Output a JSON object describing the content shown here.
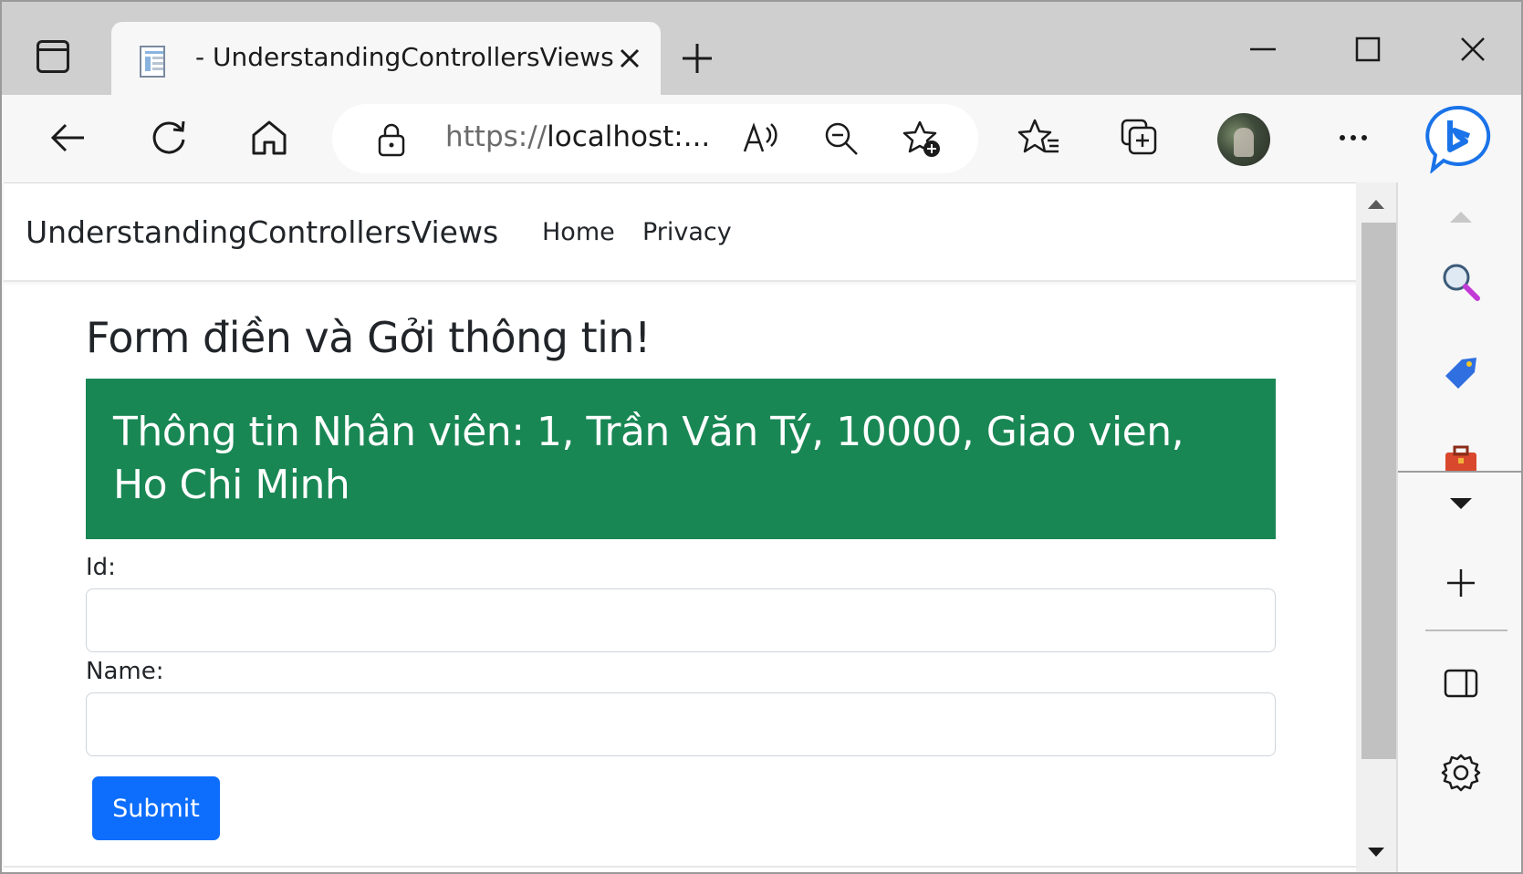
{
  "browser": {
    "tab_title": "- UnderstandingControllersViews",
    "url_protocol": "https://",
    "url_host": "localhost:...",
    "icons": {
      "tab_actions": "tab-actions-icon",
      "favicon": "document-icon",
      "close": "close-icon",
      "new_tab": "plus-icon",
      "back": "back-arrow-icon",
      "refresh": "refresh-icon",
      "home": "home-icon",
      "lock": "lock-icon",
      "read_aloud": "read-aloud-icon",
      "zoom": "zoom-out-icon",
      "add_favorite": "add-favorite-icon",
      "favorites": "favorites-icon",
      "collections": "collections-icon",
      "more": "more-icon",
      "bing": "bing-chat-icon"
    }
  },
  "page": {
    "brand": "UnderstandingControllersViews",
    "nav": [
      "Home",
      "Privacy"
    ],
    "heading": "Form điền và Gởi thông tin!",
    "alert_text": "Thông tin Nhân viên: 1, Trần Văn Tý, 10000, Giao vien, Ho Chi Minh",
    "fields": [
      {
        "label": "Id:",
        "value": ""
      },
      {
        "label": "Name:",
        "value": ""
      }
    ],
    "submit_label": "Submit"
  },
  "colors": {
    "alert_bg": "#198754",
    "button_bg": "#0d6efd",
    "tabbar_bg": "#cfcfcf",
    "bing_blue": "#1a73e8"
  }
}
